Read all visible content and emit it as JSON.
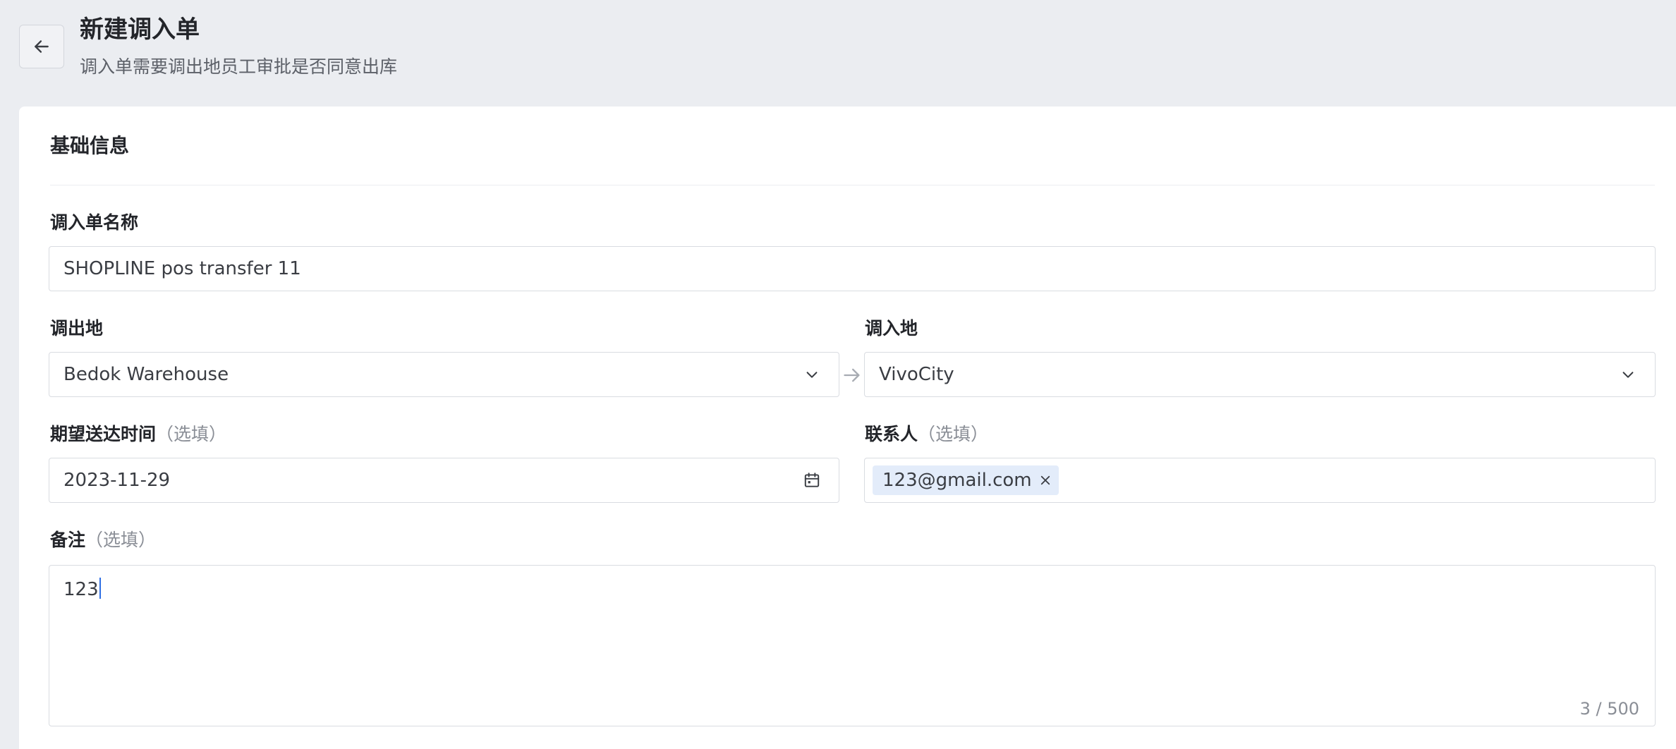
{
  "header": {
    "title": "新建调入单",
    "subtitle": "调入单需要调出地员工审批是否同意出库"
  },
  "section": {
    "title": "基础信息"
  },
  "form": {
    "name": {
      "label": "调入单名称",
      "value": "SHOPLINE pos transfer 11"
    },
    "from": {
      "label": "调出地",
      "value": "Bedok Warehouse"
    },
    "to": {
      "label": "调入地",
      "value": "VivoCity"
    },
    "date": {
      "label": "期望送达时间",
      "optional": "（选填）",
      "value": "2023-11-29"
    },
    "contact": {
      "label": "联系人",
      "optional": "（选填）",
      "tag": "123@gmail.com"
    },
    "note": {
      "label": "备注",
      "optional": "（选填）",
      "value": "123",
      "counter": "3 / 500"
    }
  },
  "icons": {
    "back": "arrow-left-icon",
    "select": "chevron-down-icon",
    "separator": "arrow-right-icon",
    "calendar": "calendar-icon",
    "tag_remove": "close-icon"
  }
}
